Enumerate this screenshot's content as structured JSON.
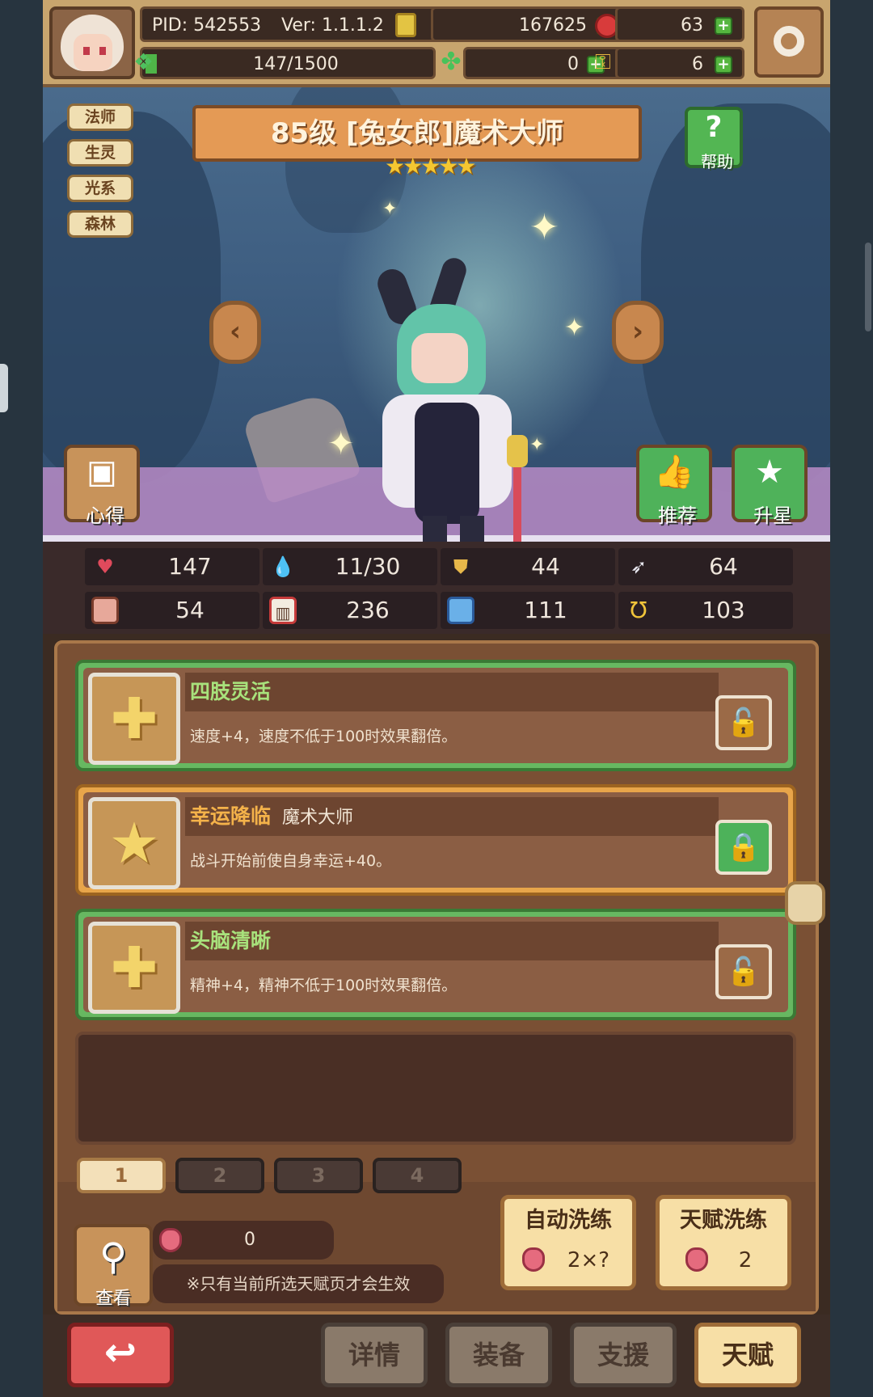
{
  "topbar": {
    "pid": "PID: 542553",
    "version": "Ver: 1.1.1.2",
    "gold": "167625",
    "ruby": "63",
    "stamina": "147/1500",
    "clover": "0",
    "key": "6"
  },
  "scene": {
    "tags": [
      "法师",
      "生灵",
      "光系",
      "森林"
    ],
    "title": "85级 [兔女郎]魔术大师",
    "stars": "★★★★★",
    "help_label": "帮助",
    "notes_label": "心得",
    "recommend_label": "推荐",
    "starup_label": "升星"
  },
  "stats": {
    "hp": "147",
    "mana": "11/30",
    "defense": "44",
    "speed": "64",
    "strength": "54",
    "intellect": "236",
    "spirit": "111",
    "luck": "103"
  },
  "talents": [
    {
      "name": "四肢灵活",
      "sub": "",
      "desc": "速度+4，速度不低于100时效果翻倍。",
      "icon": "cross-icon",
      "color": "#a8e27c"
    },
    {
      "name": "幸运降临",
      "sub": "魔术大师",
      "desc": "战斗开始前使自身幸运+40。",
      "icon": "star-icon",
      "color": "#f4b24a"
    },
    {
      "name": "头脑清晰",
      "sub": "",
      "desc": "精神+4，精神不低于100时效果翻倍。",
      "icon": "cross-icon",
      "color": "#a8e27c"
    }
  ],
  "pages": [
    "1",
    "2",
    "3",
    "4"
  ],
  "footer": {
    "view_label": "查看",
    "fruit_count": "0",
    "note": "※只有当前所选天赋页才会生效",
    "auto_refine_label": "自动洗练",
    "auto_refine_cost": "2×?",
    "talent_refine_label": "天赋洗练",
    "talent_refine_cost": "2"
  },
  "nav": {
    "back_icon": "return-arrow-icon",
    "details": "详情",
    "equipment": "装备",
    "support": "支援",
    "talent": "天赋"
  }
}
